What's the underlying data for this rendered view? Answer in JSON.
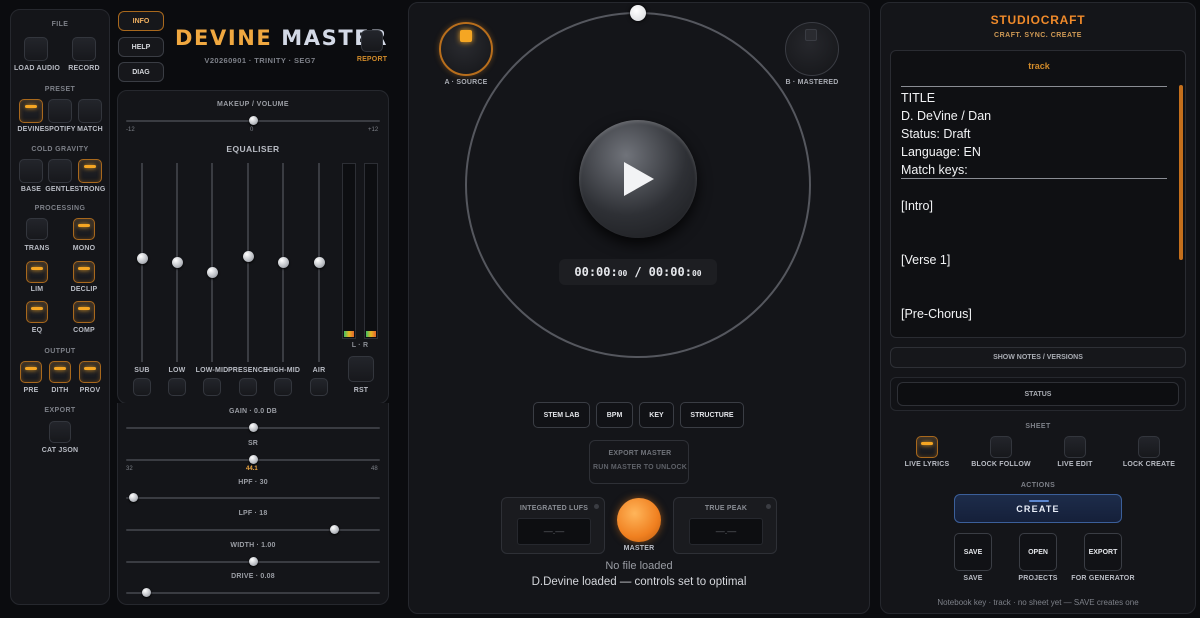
{
  "left": {
    "file_title": "FILE",
    "load_audio": "LOAD AUDIO",
    "record": "RECORD",
    "preset_title": "PRESET",
    "preset_items": [
      "DEVINE",
      "SPOTIFY",
      "MATCH"
    ],
    "cold_gravity_title": "COLD GRAVITY",
    "cold_items": [
      "BASE",
      "GENTLE",
      "STRONG"
    ],
    "processing_title": "PROCESSING",
    "trans": "TRANS",
    "mono": "MONO",
    "lim": "LIM",
    "declip": "DECLIP",
    "eq": "EQ",
    "comp": "COMP",
    "output_title": "OUTPUT",
    "output_items": [
      "PRE",
      "DITH",
      "PROV"
    ],
    "export_title": "EXPORT",
    "cat_json": "CAT JSON"
  },
  "header": {
    "info": "INFO",
    "help": "HELP",
    "diag": "DIAG",
    "title_part1": "DEVINE",
    "title_part2": "MASTER",
    "version": "V20260901 · TRINITY · SEG7",
    "report": "REPORT"
  },
  "eq": {
    "makeup_label": "MAKEUP / VOLUME",
    "makeup_min": "-12",
    "makeup_mid": "0",
    "makeup_max": "+12",
    "makeup_value": 0.5,
    "title": "EQUALISER",
    "bands": [
      {
        "name": "SUB",
        "level": 0.52
      },
      {
        "name": "LOW",
        "level": 0.5
      },
      {
        "name": "LOW-MID",
        "level": 0.45
      },
      {
        "name": "PRESENCE",
        "level": 0.53
      },
      {
        "name": "HIGH-MID",
        "level": 0.5
      },
      {
        "name": "AIR",
        "level": 0.5
      }
    ],
    "meter_label": "L · R",
    "rst": "RST"
  },
  "params": {
    "gain_label": "GAIN · 0.0 DB",
    "gain_value": 0.5,
    "sr_label": "SR",
    "sr_min": "32",
    "sr_value_text": "44.1",
    "sr_max": "48",
    "sr_value": 0.5,
    "hpf_label": "HPF · 30",
    "hpf_value": 0.03,
    "lpf_label": "LPF · 18",
    "lpf_value": 0.82,
    "width_label": "WIDTH · 1.00",
    "width_value": 0.5,
    "drive_label": "DRIVE · 0.08",
    "drive_value": 0.08
  },
  "center": {
    "a_source": "A · SOURCE",
    "b_mastered": "B · MASTERED",
    "time_current": "00:00:",
    "time_current_ms": "00",
    "time_sep": "/",
    "time_total": "00:00:",
    "time_total_ms": "00",
    "tools": [
      "STEM LAB",
      "BPM",
      "KEY",
      "STRUCTURE"
    ],
    "export_master": "EXPORT MASTER",
    "run_to_unlock": "RUN MASTER TO UNLOCK",
    "integrated_lufs": "INTEGRATED LUFS",
    "lufs_value": "—.—",
    "true_peak": "TRUE PEAK",
    "peak_value": "—.—",
    "master": "MASTER",
    "no_file": "No file loaded",
    "status": "D.Devine loaded — controls set to optimal"
  },
  "right": {
    "brand": "STUDIOCRAFT",
    "tagline": "CRAFT. SYNC. CREATE",
    "track_label": "track",
    "lyrics_lines": [
      "TITLE",
      "D. DeVine / Dan",
      "Status: Draft",
      "Language: EN",
      "Match keys:",
      "",
      "[Intro]",
      "",
      "",
      "[Verse 1]",
      "",
      "",
      "[Pre-Chorus]"
    ],
    "show_notes": "SHOW NOTES / VERSIONS",
    "status": "STATUS",
    "sheet_title": "SHEET",
    "sheet_items": [
      "LIVE LYRICS",
      "BLOCK FOLLOW",
      "LIVE EDIT",
      "LOCK CREATE"
    ],
    "actions_title": "ACTIONS",
    "create": "CREATE",
    "save_btn": "SAVE",
    "save_lbl": "SAVE",
    "open_btn": "OPEN",
    "open_lbl": "PROJECTS",
    "export_btn": "EXPORT",
    "export_lbl": "FOR GENERATOR",
    "footer": "Notebook key · track · no sheet yet — SAVE creates one"
  },
  "colors": {
    "accent": "#f5a623",
    "title_gradient_start": "#f3b04a",
    "title_gradient_end": "#d5dbe8"
  }
}
